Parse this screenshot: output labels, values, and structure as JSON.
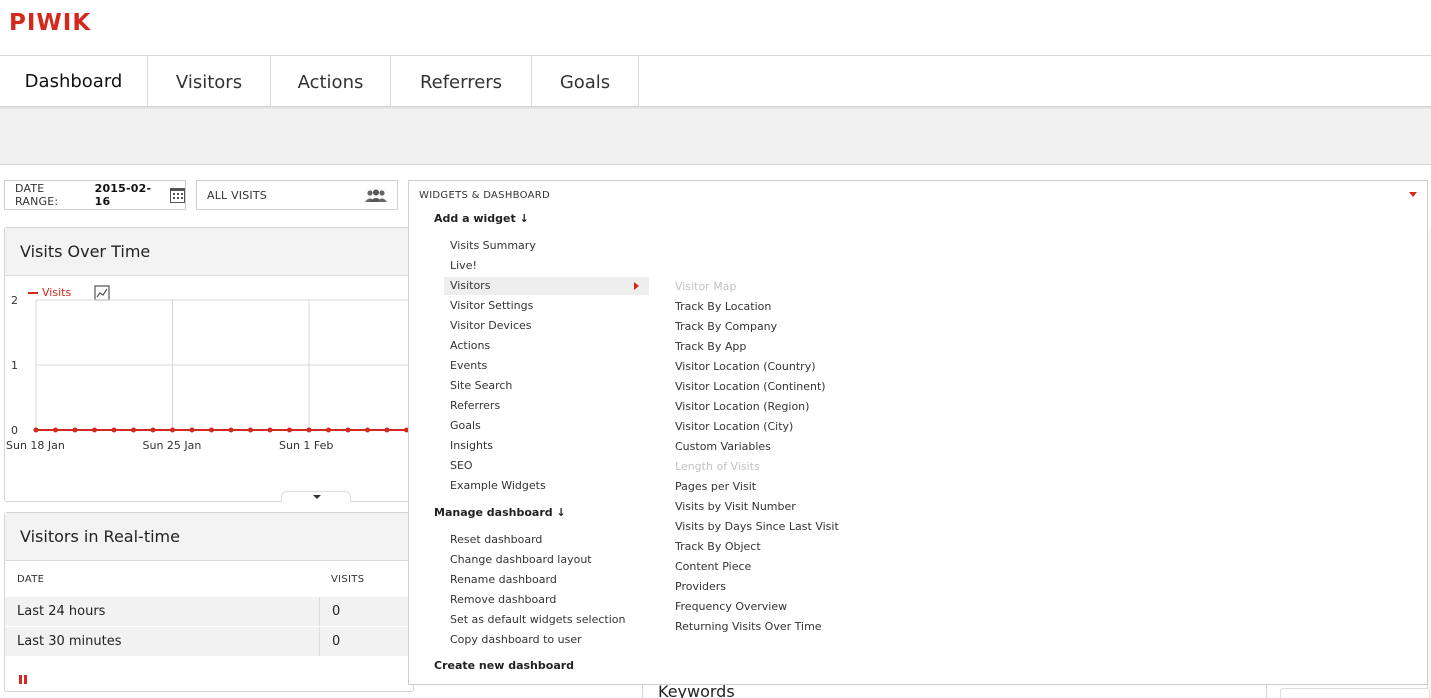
{
  "app": {
    "logo": "PIWIK"
  },
  "menu": {
    "tabs": [
      {
        "label": "Dashboard",
        "active": true
      },
      {
        "label": "Visitors"
      },
      {
        "label": "Actions"
      },
      {
        "label": "Referrers"
      },
      {
        "label": "Goals"
      }
    ]
  },
  "date_selector": {
    "label": "DATE RANGE:",
    "value": "2015-02-16",
    "icon": "calendar-icon"
  },
  "segment_selector": {
    "label": "ALL VISITS",
    "icon": "people-icon"
  },
  "visits_over_time": {
    "title": "Visits Over Time",
    "legend": "Visits",
    "y_ticks": [
      "2",
      "1",
      "0"
    ],
    "x_ticks": [
      "Sun 18 Jan",
      "Sun 25 Jan",
      "Sun 1 Feb"
    ]
  },
  "chart_data": {
    "type": "line",
    "series": [
      {
        "name": "Visits",
        "values": [
          0,
          0,
          0,
          0,
          0,
          0,
          0,
          0,
          0,
          0,
          0,
          0,
          0,
          0,
          0,
          0,
          0,
          0,
          0,
          0,
          0
        ]
      }
    ],
    "x_tick_labels": [
      "Sun 18 Jan",
      "Sun 25 Jan",
      "Sun 1 Feb"
    ],
    "ylim": [
      0,
      2
    ],
    "y_ticks": [
      0,
      1,
      2
    ],
    "grid": true,
    "color": "#d4291f"
  },
  "realtime": {
    "title": "Visitors in Real-time",
    "columns": [
      "DATE",
      "VISITS"
    ],
    "rows": [
      {
        "date": "Last 24 hours",
        "visits": "0"
      },
      {
        "date": "Last 30 minutes",
        "visits": "0"
      }
    ]
  },
  "keywords": {
    "title": "Keywords"
  },
  "widgets_menu": {
    "header": "WIDGETS & DASHBOARD",
    "add_widget": "Add a widget ↓",
    "categories": [
      "Visits Summary",
      "Live!",
      "Visitors",
      "Visitor Settings",
      "Visitor Devices",
      "Actions",
      "Events",
      "Site Search",
      "Referrers",
      "Goals",
      "Insights",
      "SEO",
      "Example Widgets"
    ],
    "highlighted": "Visitors",
    "manage_dashboard": "Manage dashboard ↓",
    "manage_items": [
      "Reset dashboard",
      "Change dashboard layout",
      "Rename dashboard",
      "Remove dashboard",
      "Set as default widgets selection",
      "Copy dashboard to user"
    ],
    "create_new": "Create new dashboard",
    "visitor_widgets": [
      {
        "label": "Visitor Map",
        "disabled": true
      },
      {
        "label": "Track By Location"
      },
      {
        "label": "Track By Company"
      },
      {
        "label": "Track By App"
      },
      {
        "label": "Visitor Location (Country)"
      },
      {
        "label": "Visitor Location (Continent)"
      },
      {
        "label": "Visitor Location (Region)"
      },
      {
        "label": "Visitor Location (City)"
      },
      {
        "label": "Custom Variables"
      },
      {
        "label": "Length of Visits",
        "disabled": true
      },
      {
        "label": "Pages per Visit"
      },
      {
        "label": "Visits by Visit Number"
      },
      {
        "label": "Visits by Days Since Last Visit"
      },
      {
        "label": "Track By Object"
      },
      {
        "label": "Content Piece"
      },
      {
        "label": "Providers"
      },
      {
        "label": "Frequency Overview"
      },
      {
        "label": "Returning Visits Over Time"
      }
    ]
  },
  "colors": {
    "accent": "#d4291f"
  }
}
